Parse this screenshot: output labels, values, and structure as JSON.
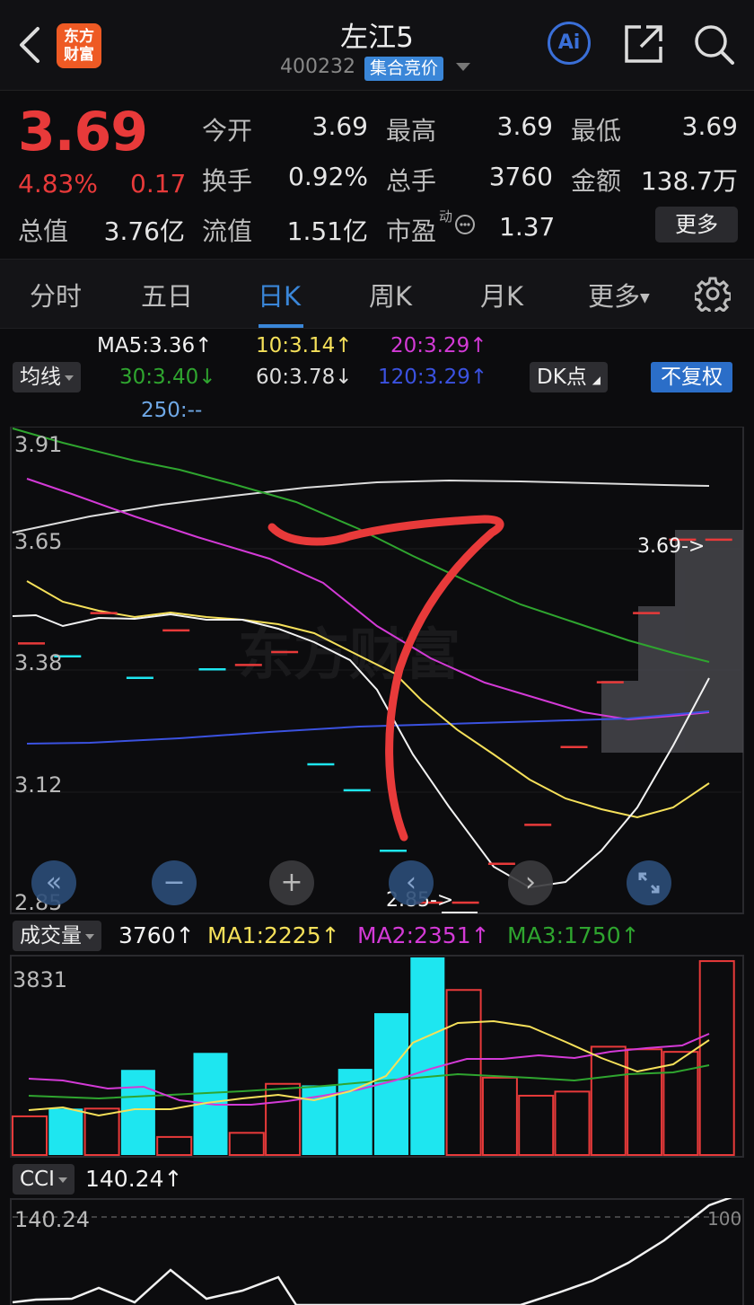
{
  "header": {
    "logo_text": "东方\n财富",
    "title": "左江5",
    "code": "400232",
    "badge": "集合竞价",
    "ai_label": "Ai"
  },
  "quote": {
    "price": "3.69",
    "change_pct": "4.83%",
    "change": "0.17",
    "rows": [
      [
        {
          "l": "今开",
          "v": "3.69",
          "red": true
        },
        {
          "l": "最高",
          "v": "3.69",
          "red": true
        },
        {
          "l": "最低",
          "v": "3.69",
          "red": true
        }
      ],
      [
        {
          "l": "换手",
          "v": "0.92%"
        },
        {
          "l": "总手",
          "v": "3760"
        },
        {
          "l": "金额",
          "v": "138.7万"
        }
      ]
    ],
    "total_value_label": "总值",
    "total_value": "3.76亿",
    "float_value_label": "流值",
    "float_value": "1.51亿",
    "pe_label": "市盈",
    "pe_sup": "动",
    "pe_value": "1.37",
    "more_label": "更多"
  },
  "tabs": {
    "items": [
      "分时",
      "五日",
      "日K",
      "周K",
      "月K",
      "更多"
    ],
    "active_index": 2
  },
  "ma_legend": {
    "ma5": "MA5:3.36",
    "ma10": "10:3.14",
    "ma20": "20:3.29",
    "ma30": "30:3.40",
    "ma60": "60:3.78",
    "ma120": "120:3.29",
    "ma250": "250:--",
    "up": "↑",
    "down": "↓",
    "mode_label": "均线",
    "dk_label": "DK点",
    "adjust_label": "不复权"
  },
  "price_axis": [
    "3.91",
    "3.65",
    "3.38",
    "3.12",
    "2.85"
  ],
  "price_annotations": {
    "high": "3.69->",
    "low": "2.85->"
  },
  "watermark": "东方财富",
  "volume_legend": {
    "label": "成交量",
    "value": "3760",
    "ma1": "MA1:2225",
    "ma2": "MA2:2351",
    "ma3": "MA3:1750",
    "up": "↑",
    "axis_max": "3831"
  },
  "cci_legend": {
    "label": "CCI",
    "value": "140.24",
    "up": "↑",
    "axis_top": "140.24",
    "level_100": "100"
  },
  "colors": {
    "up": "#e83a3a",
    "down": "#1ee6f0",
    "accent": "#3a86d8",
    "ma5": "#f2f2f2",
    "ma10": "#f5e05a",
    "ma20": "#d33ad6",
    "ma30": "#2fa52f",
    "ma60": "#dcdcdc",
    "ma120": "#3b52e0"
  },
  "chart_data": {
    "type": "candlestick",
    "ylim": [
      2.85,
      3.91
    ],
    "candles": [
      {
        "price": 3.45,
        "dir": "up"
      },
      {
        "price": 3.42,
        "dir": "down"
      },
      {
        "price": 3.52,
        "dir": "up"
      },
      {
        "price": 3.37,
        "dir": "down"
      },
      {
        "price": 3.48,
        "dir": "up"
      },
      {
        "price": 3.39,
        "dir": "down"
      },
      {
        "price": 3.4,
        "dir": "up"
      },
      {
        "price": 3.43,
        "dir": "up"
      },
      {
        "price": 3.17,
        "dir": "down"
      },
      {
        "price": 3.11,
        "dir": "down"
      },
      {
        "price": 2.97,
        "dir": "down"
      },
      {
        "price": 2.85,
        "dir": "up"
      },
      {
        "price": 2.85,
        "dir": "up"
      },
      {
        "price": 2.94,
        "dir": "up"
      },
      {
        "price": 3.03,
        "dir": "up"
      },
      {
        "price": 3.21,
        "dir": "up"
      },
      {
        "price": 3.36,
        "dir": "up"
      },
      {
        "price": 3.52,
        "dir": "up"
      },
      {
        "price": 3.69,
        "dir": "up"
      },
      {
        "price": 3.69,
        "dir": "up"
      }
    ],
    "volume": {
      "ylim": [
        0,
        3831
      ],
      "bars": [
        {
          "v": 750,
          "dir": "up"
        },
        {
          "v": 900,
          "dir": "down"
        },
        {
          "v": 900,
          "dir": "up"
        },
        {
          "v": 1650,
          "dir": "down"
        },
        {
          "v": 350,
          "dir": "up"
        },
        {
          "v": 1980,
          "dir": "down"
        },
        {
          "v": 430,
          "dir": "up"
        },
        {
          "v": 1380,
          "dir": "up"
        },
        {
          "v": 1350,
          "dir": "down"
        },
        {
          "v": 1670,
          "dir": "down"
        },
        {
          "v": 2750,
          "dir": "down"
        },
        {
          "v": 3831,
          "dir": "down"
        },
        {
          "v": 3200,
          "dir": "up"
        },
        {
          "v": 1500,
          "dir": "up"
        },
        {
          "v": 1150,
          "dir": "up"
        },
        {
          "v": 1230,
          "dir": "up"
        },
        {
          "v": 2100,
          "dir": "up"
        },
        {
          "v": 2050,
          "dir": "up"
        },
        {
          "v": 2000,
          "dir": "up"
        },
        {
          "v": 3760,
          "dir": "up"
        }
      ]
    }
  }
}
